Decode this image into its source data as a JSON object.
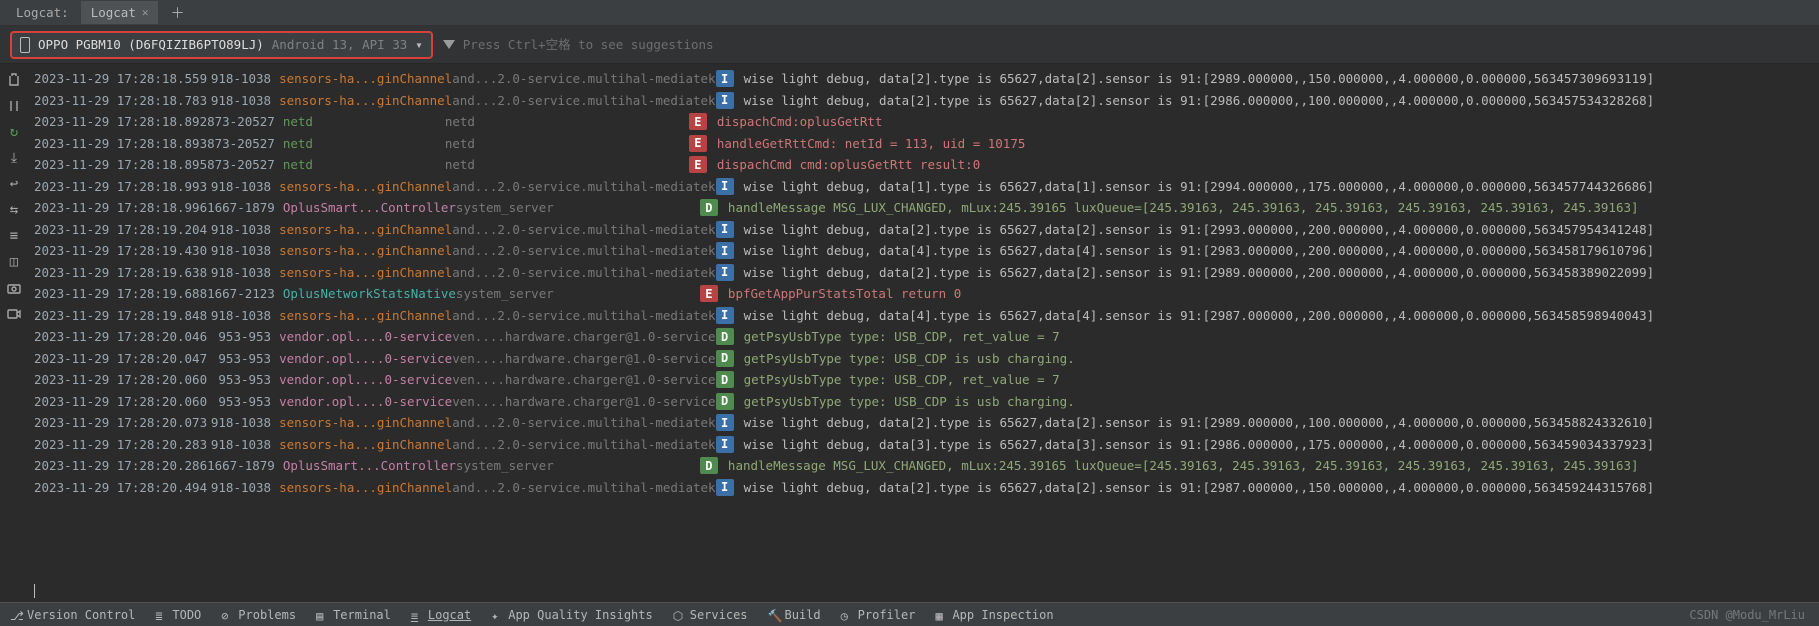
{
  "tabs": {
    "label": "Logcat:",
    "active": "Logcat"
  },
  "device": {
    "name": "OPPO PGBM10 (D6FQIZIB6PTO89LJ)",
    "sub": "Android 13, API 33"
  },
  "filter": {
    "placeholder": "Press Ctrl+空格 to see suggestions"
  },
  "rows": [
    {
      "ts": "2023-11-29 17:28:18.559",
      "pid": "918-1038",
      "tag": "sensors-ha...ginChannel",
      "tagc": "orange",
      "app": "and...2.0-service.multihal-mediatek",
      "lvl": "I",
      "msg": "wise light debug, data[2].type is 65627,data[2].sensor is 91:[2989.000000,,150.000000,,4.000000,0.000000,563457309693119]"
    },
    {
      "ts": "2023-11-29 17:28:18.783",
      "pid": "918-1038",
      "tag": "sensors-ha...ginChannel",
      "tagc": "orange",
      "app": "and...2.0-service.multihal-mediatek",
      "lvl": "I",
      "msg": "wise light debug, data[2].type is 65627,data[2].sensor is 91:[2986.000000,,100.000000,,4.000000,0.000000,563457534328268]"
    },
    {
      "ts": "2023-11-29 17:28:18.892",
      "pid": "873-20527",
      "tag": "netd",
      "tagc": "green",
      "app": "netd",
      "lvl": "E",
      "msg": "dispachCmd:oplusGetRtt"
    },
    {
      "ts": "2023-11-29 17:28:18.893",
      "pid": "873-20527",
      "tag": "netd",
      "tagc": "green",
      "app": "netd",
      "lvl": "E",
      "msg": "handleGetRttCmd: netId = 113, uid = 10175"
    },
    {
      "ts": "2023-11-29 17:28:18.895",
      "pid": "873-20527",
      "tag": "netd",
      "tagc": "green",
      "app": "netd",
      "lvl": "E",
      "msg": "dispachCmd cmd:oplusGetRtt  result:0"
    },
    {
      "ts": "2023-11-29 17:28:18.993",
      "pid": "918-1038",
      "tag": "sensors-ha...ginChannel",
      "tagc": "orange",
      "app": "and...2.0-service.multihal-mediatek",
      "lvl": "I",
      "msg": "wise light debug, data[1].type is 65627,data[1].sensor is 91:[2994.000000,,175.000000,,4.000000,0.000000,563457744326686]"
    },
    {
      "ts": "2023-11-29 17:28:18.996",
      "pid": "1667-1879",
      "tag": "OplusSmart...Controller",
      "tagc": "magenta",
      "app": "system_server",
      "lvl": "D",
      "msg": "handleMessage MSG_LUX_CHANGED, mLux:245.39165 luxQueue=[245.39163, 245.39163, 245.39163, 245.39163, 245.39163, 245.39163]"
    },
    {
      "ts": "2023-11-29 17:28:19.204",
      "pid": "918-1038",
      "tag": "sensors-ha...ginChannel",
      "tagc": "orange",
      "app": "and...2.0-service.multihal-mediatek",
      "lvl": "I",
      "msg": "wise light debug, data[2].type is 65627,data[2].sensor is 91:[2993.000000,,200.000000,,4.000000,0.000000,563457954341248]"
    },
    {
      "ts": "2023-11-29 17:28:19.430",
      "pid": "918-1038",
      "tag": "sensors-ha...ginChannel",
      "tagc": "orange",
      "app": "and...2.0-service.multihal-mediatek",
      "lvl": "I",
      "msg": "wise light debug, data[4].type is 65627,data[4].sensor is 91:[2983.000000,,200.000000,,4.000000,0.000000,563458179610796]"
    },
    {
      "ts": "2023-11-29 17:28:19.638",
      "pid": "918-1038",
      "tag": "sensors-ha...ginChannel",
      "tagc": "orange",
      "app": "and...2.0-service.multihal-mediatek",
      "lvl": "I",
      "msg": "wise light debug, data[2].type is 65627,data[2].sensor is 91:[2989.000000,,200.000000,,4.000000,0.000000,563458389022099]"
    },
    {
      "ts": "2023-11-29 17:28:19.688",
      "pid": "1667-2123",
      "tag": "OplusNetworkStatsNative",
      "tagc": "teal",
      "app": "system_server",
      "lvl": "E",
      "msg": "bpfGetAppPurStatsTotal return 0"
    },
    {
      "ts": "2023-11-29 17:28:19.848",
      "pid": "918-1038",
      "tag": "sensors-ha...ginChannel",
      "tagc": "orange",
      "app": "and...2.0-service.multihal-mediatek",
      "lvl": "I",
      "msg": "wise light debug, data[4].type is 65627,data[4].sensor is 91:[2987.000000,,200.000000,,4.000000,0.000000,563458598940043]"
    },
    {
      "ts": "2023-11-29 17:28:20.046",
      "pid": "953-953",
      "tag": "vendor.opl....0-service",
      "tagc": "magenta",
      "app": "ven....hardware.charger@1.0-service",
      "lvl": "D",
      "msg": "getPsyUsbType type: USB_CDP, ret_value = 7"
    },
    {
      "ts": "2023-11-29 17:28:20.047",
      "pid": "953-953",
      "tag": "vendor.opl....0-service",
      "tagc": "magenta",
      "app": "ven....hardware.charger@1.0-service",
      "lvl": "D",
      "msg": "getPsyUsbType type: USB_CDP is usb charging."
    },
    {
      "ts": "2023-11-29 17:28:20.060",
      "pid": "953-953",
      "tag": "vendor.opl....0-service",
      "tagc": "magenta",
      "app": "ven....hardware.charger@1.0-service",
      "lvl": "D",
      "msg": "getPsyUsbType type: USB_CDP, ret_value = 7"
    },
    {
      "ts": "2023-11-29 17:28:20.060",
      "pid": "953-953",
      "tag": "vendor.opl....0-service",
      "tagc": "magenta",
      "app": "ven....hardware.charger@1.0-service",
      "lvl": "D",
      "msg": "getPsyUsbType type: USB_CDP is usb charging."
    },
    {
      "ts": "2023-11-29 17:28:20.073",
      "pid": "918-1038",
      "tag": "sensors-ha...ginChannel",
      "tagc": "orange",
      "app": "and...2.0-service.multihal-mediatek",
      "lvl": "I",
      "msg": "wise light debug, data[2].type is 65627,data[2].sensor is 91:[2989.000000,,100.000000,,4.000000,0.000000,563458824332610]"
    },
    {
      "ts": "2023-11-29 17:28:20.283",
      "pid": "918-1038",
      "tag": "sensors-ha...ginChannel",
      "tagc": "orange",
      "app": "and...2.0-service.multihal-mediatek",
      "lvl": "I",
      "msg": "wise light debug, data[3].type is 65627,data[3].sensor is 91:[2986.000000,,175.000000,,4.000000,0.000000,563459034337923]"
    },
    {
      "ts": "2023-11-29 17:28:20.286",
      "pid": "1667-1879",
      "tag": "OplusSmart...Controller",
      "tagc": "magenta",
      "app": "system_server",
      "lvl": "D",
      "msg": "handleMessage MSG_LUX_CHANGED, mLux:245.39165 luxQueue=[245.39163, 245.39163, 245.39163, 245.39163, 245.39163, 245.39163]"
    },
    {
      "ts": "2023-11-29 17:28:20.494",
      "pid": "918-1038",
      "tag": "sensors-ha...ginChannel",
      "tagc": "orange",
      "app": "and...2.0-service.multihal-mediatek",
      "lvl": "I",
      "msg": "wise light debug, data[2].type is 65627,data[2].sensor is 91:[2987.000000,,150.000000,,4.000000,0.000000,563459244315768]"
    }
  ],
  "bottom": {
    "vcs": "Version Control",
    "todo": "TODO",
    "problems": "Problems",
    "terminal": "Terminal",
    "logcat": "Logcat",
    "aqi": "App Quality Insights",
    "services": "Services",
    "build": "Build",
    "profiler": "Profiler",
    "appins": "App Inspection",
    "watermark": "CSDN @Modu_MrLiu"
  }
}
